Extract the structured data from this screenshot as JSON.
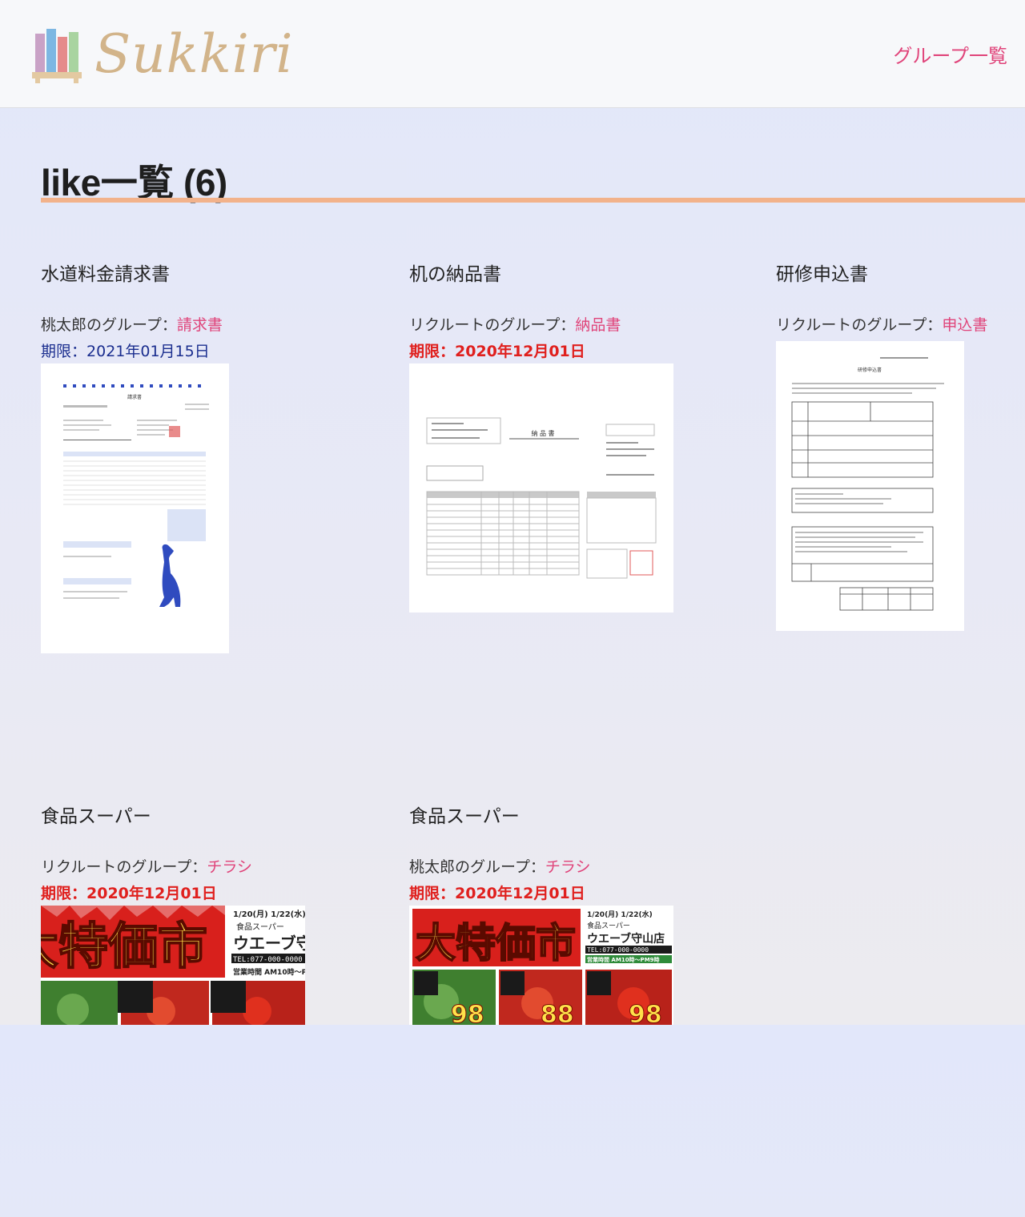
{
  "header": {
    "logo_text": "Sukkiri",
    "nav_link": "グループ一覧"
  },
  "page": {
    "title": "like一覧 (6)"
  },
  "labels": {
    "deadline_prefix": "期限：",
    "group_separator": "："
  },
  "cards": [
    {
      "title": "水道料金請求書",
      "group_owner": "桃太郎のグループ",
      "group_tag": "請求書",
      "deadline": "2021年01月15日",
      "overdue": false,
      "thumb_kind": "invoice"
    },
    {
      "title": "机の納品書",
      "group_owner": "リクルートのグループ",
      "group_tag": "納品書",
      "deadline": "2020年12月01日",
      "overdue": true,
      "thumb_kind": "delivery"
    },
    {
      "title": "研修申込書",
      "group_owner": "リクルートのグループ",
      "group_tag": "申込書",
      "deadline": "",
      "overdue": false,
      "thumb_kind": "application"
    },
    {
      "title": "食品スーパー",
      "group_owner": "リクルートのグループ",
      "group_tag": "チラシ",
      "deadline": "2020年12月01日",
      "overdue": true,
      "thumb_kind": "flyer"
    },
    {
      "title": "食品スーパー",
      "group_owner": "桃太郎のグループ",
      "group_tag": "チラシ",
      "deadline": "2020年12月01日",
      "overdue": true,
      "thumb_kind": "flyer"
    }
  ],
  "thumb_text": {
    "invoice_heading": "請求書",
    "delivery_heading": "納 品 書",
    "application_heading": "研修申込書",
    "flyer_headline": "大特価市",
    "flyer_shop_small": "食品スーパー",
    "flyer_shop": "ウエーブ守山店",
    "flyer_tel": "TEL:077-000-0000",
    "flyer_hours": "営業時間 AM10時〜PM9時",
    "flyer_dates": "1/20(月) 1/22(水)",
    "flyer_price": "98",
    "flyer_price2": "88"
  },
  "colors": {
    "accent": "#e0447a",
    "title_rule": "#f2b28b",
    "deadline_normal": "#1b2e8f",
    "deadline_overdue": "#e0201e",
    "logo_text": "#d2b48a",
    "flyer_red": "#d8201c",
    "flyer_yellow": "#ffe24a"
  }
}
